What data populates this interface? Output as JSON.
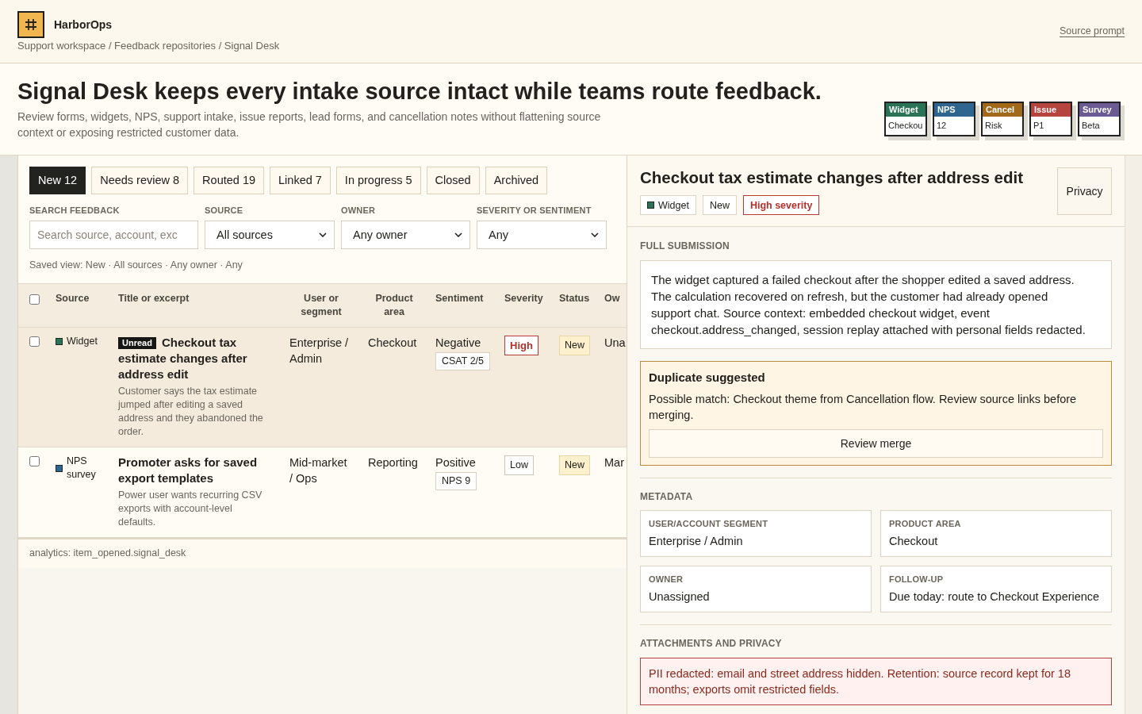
{
  "app": {
    "name": "HarborOps",
    "breadcrumb": "Support workspace / Feedback repositories / Signal Desk",
    "link": "Source prompt"
  },
  "hero": {
    "title": "Signal Desk keeps every intake source intact while teams route feedback.",
    "subtitle": "Review forms, widgets, NPS, support intake, issue reports, lead forms, and cancellation notes without flattening source context or exposing restricted customer data.",
    "legend": [
      {
        "label": "Widget",
        "value": "Checkou",
        "color": "#2b7357"
      },
      {
        "label": "NPS",
        "value": "12",
        "color": "#2f6690"
      },
      {
        "label": "Cancel",
        "value": "Risk",
        "color": "#a2691b"
      },
      {
        "label": "Issue",
        "value": "P1",
        "color": "#b5443f"
      },
      {
        "label": "Survey",
        "value": "Beta",
        "color": "#6c5a94"
      }
    ]
  },
  "tabs": [
    {
      "label": "New 12",
      "selected": true
    },
    {
      "label": "Needs review 8",
      "selected": false
    },
    {
      "label": "Routed 19",
      "selected": false
    },
    {
      "label": "Linked 7",
      "selected": false
    },
    {
      "label": "In progress 5",
      "selected": false
    },
    {
      "label": "Closed",
      "selected": false
    },
    {
      "label": "Archived",
      "selected": false
    }
  ],
  "filters": {
    "fields": [
      {
        "kind": "search",
        "label": "SEARCH FEEDBACK",
        "placeholder": "Search source, account, exc"
      },
      {
        "kind": "select",
        "label": "SOURCE",
        "value": "All sources"
      },
      {
        "kind": "select",
        "label": "OWNER",
        "value": "Any owner"
      },
      {
        "kind": "select",
        "label": "SEVERITY OR SENTIMENT",
        "value": "Any"
      }
    ],
    "saved_view": "Saved view: New · All sources · Any owner · Any"
  },
  "table": {
    "select_all": {
      "checked": false
    },
    "columns": [
      "Source",
      "Title or excerpt",
      "User or segment",
      "Product area",
      "Sentiment",
      "Severity",
      "Status",
      "Ow"
    ],
    "rows": [
      {
        "checked": false,
        "selected": true,
        "source": {
          "label": "Widget",
          "color": "#2b7357"
        },
        "tag": "Unread",
        "title": "Checkout tax estimate changes after address edit",
        "excerpt": "Customer says the tax estimate jumped after editing a saved address and they abandoned the order.",
        "segment": "Enterprise / Admin",
        "area": "Checkout",
        "sentiment": "Negative",
        "score": "CSAT 2/5",
        "severity": {
          "label": "High",
          "kind": "high"
        },
        "status": "New",
        "owner": "Una"
      },
      {
        "checked": false,
        "selected": false,
        "source": {
          "label": "NPS survey",
          "color": "#2f6690"
        },
        "title": "Promoter asks for saved export templates",
        "excerpt": "Power user wants recurring CSV exports with account-level defaults.",
        "segment": "Mid-market / Ops",
        "area": "Reporting",
        "sentiment": "Positive",
        "score": "NPS 9",
        "severity": {
          "label": "Low",
          "kind": "low"
        },
        "status": "New",
        "owner": "Mar"
      }
    ]
  },
  "analytics": "analytics: item_opened.signal_desk",
  "detail": {
    "title": "Checkout tax estimate changes after address edit",
    "tags": [
      {
        "kind": "source",
        "label": "Widget",
        "color": "#2b7357"
      },
      {
        "kind": "status",
        "label": "New"
      },
      {
        "kind": "severity",
        "label": "High severity"
      }
    ],
    "action": "Privacy",
    "submission": {
      "label": "FULL SUBMISSION",
      "text": "The widget captured a failed checkout after the shopper edited a saved address. The calculation recovered on refresh, but the customer had already opened support chat. Source context: embedded checkout widget, event checkout.address_changed, session replay attached with personal fields redacted."
    },
    "duplicate": {
      "title": "Duplicate suggested",
      "text": "Possible match: Checkout theme from Cancellation flow. Review source links before merging.",
      "button": "Review merge"
    },
    "metadata": {
      "label": "METADATA",
      "fields": [
        {
          "label": "USER/ACCOUNT SEGMENT",
          "value": "Enterprise / Admin"
        },
        {
          "label": "PRODUCT AREA",
          "value": "Checkout"
        },
        {
          "label": "OWNER",
          "value": "Unassigned"
        },
        {
          "label": "FOLLOW-UP",
          "value": "Due today: route to Checkout Experience"
        }
      ]
    },
    "privacy": {
      "label": "ATTACHMENTS AND PRIVACY",
      "notice": "PII redacted: email and street address hidden. Retention: source record kept for 18 months; exports omit restricted fields."
    }
  }
}
